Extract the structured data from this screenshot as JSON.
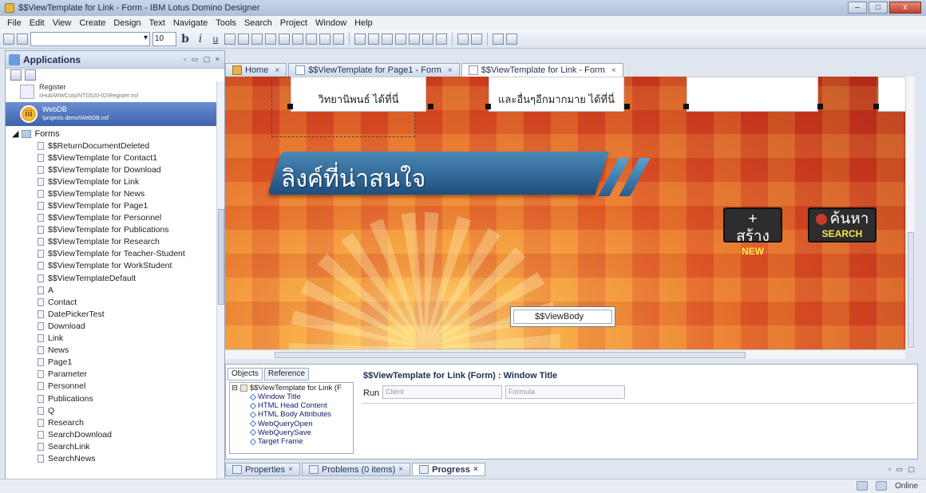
{
  "window": {
    "title": "$$ViewTemplate for Link - Form - IBM Lotus Domino Designer",
    "minimize": "–",
    "maximize": "□",
    "close": "x"
  },
  "menu": [
    "File",
    "Edit",
    "View",
    "Create",
    "Design",
    "Text",
    "Navigate",
    "Tools",
    "Search",
    "Project",
    "Window",
    "Help"
  ],
  "toolbar": {
    "font_size": "10",
    "bold": "b",
    "italic": "i",
    "underline": "u"
  },
  "applications": {
    "title": "Applications",
    "databases": [
      {
        "name": "Register",
        "path": "IIHub/WWCorp/NTD520-02\\Register.nsf"
      },
      {
        "name": "WebDB",
        "path": "\\projects demo\\WebDB.nsf",
        "selected": true
      }
    ],
    "db_icon_glyph": "iii",
    "folder": "Forms",
    "forms": [
      "$$ReturnDocumentDeleted",
      "$$ViewTemplate for Contact1",
      "$$ViewTemplate for Download",
      "$$ViewTemplate for Link",
      "$$ViewTemplate for News",
      "$$ViewTemplate for Page1",
      "$$ViewTemplate for Personnel",
      "$$ViewTemplate for Publications",
      "$$ViewTemplate for Research",
      "$$ViewTemplate for Teacher-Student",
      "$$ViewTemplate for WorkStudent",
      "$$ViewTemplateDefault",
      "A",
      "Contact",
      "DatePickerTest",
      "Download",
      "Link",
      "News",
      "Page1",
      "Parameter",
      "Personnel",
      "Publications",
      "Q",
      "Research",
      "SearchDownload",
      "SearchLink",
      "SearchNews"
    ]
  },
  "tabs": [
    {
      "label": "Home",
      "close": "×"
    },
    {
      "label": "$$ViewTemplate for Page1 - Form",
      "close": "×"
    },
    {
      "label": "$$ViewTemplate for Link - Form",
      "close": "×",
      "active": true
    }
  ],
  "canvas": {
    "card1_text": "วิทยานิพนธ์ ได้ที่นี่",
    "card2_text": "และอื่นๆอีกมากมาย ได้ที่นี่",
    "card3_text": "",
    "banner_title": "ลิงค์ที่น่าสนใจ",
    "create_button": {
      "label": "+ สร้าง",
      "sub": "NEW"
    },
    "search_button": {
      "label": "ค้นหา",
      "sub": "SEARCH"
    },
    "view_body": "$$ViewBody"
  },
  "objects_panel": {
    "tab_objects": "Objects",
    "tab_reference": "Reference",
    "root": "$$ViewTemplate for Link (F",
    "items": [
      "Window Title",
      "HTML Head Content",
      "HTML Body Attributes",
      "WebQueryOpen",
      "WebQuerySave",
      "Target Frame"
    ]
  },
  "programmer": {
    "title": "$$ViewTemplate for Link (Form) : Window Title",
    "run_label": "Run",
    "run_value": "Client",
    "formula_value": "Formula"
  },
  "bottom_tabs": [
    {
      "label": "Properties",
      "close": "×"
    },
    {
      "label": "Problems (0 items)",
      "close": "×"
    },
    {
      "label": "Progress",
      "close": "×",
      "active": true
    }
  ],
  "status": {
    "online": "Online"
  }
}
